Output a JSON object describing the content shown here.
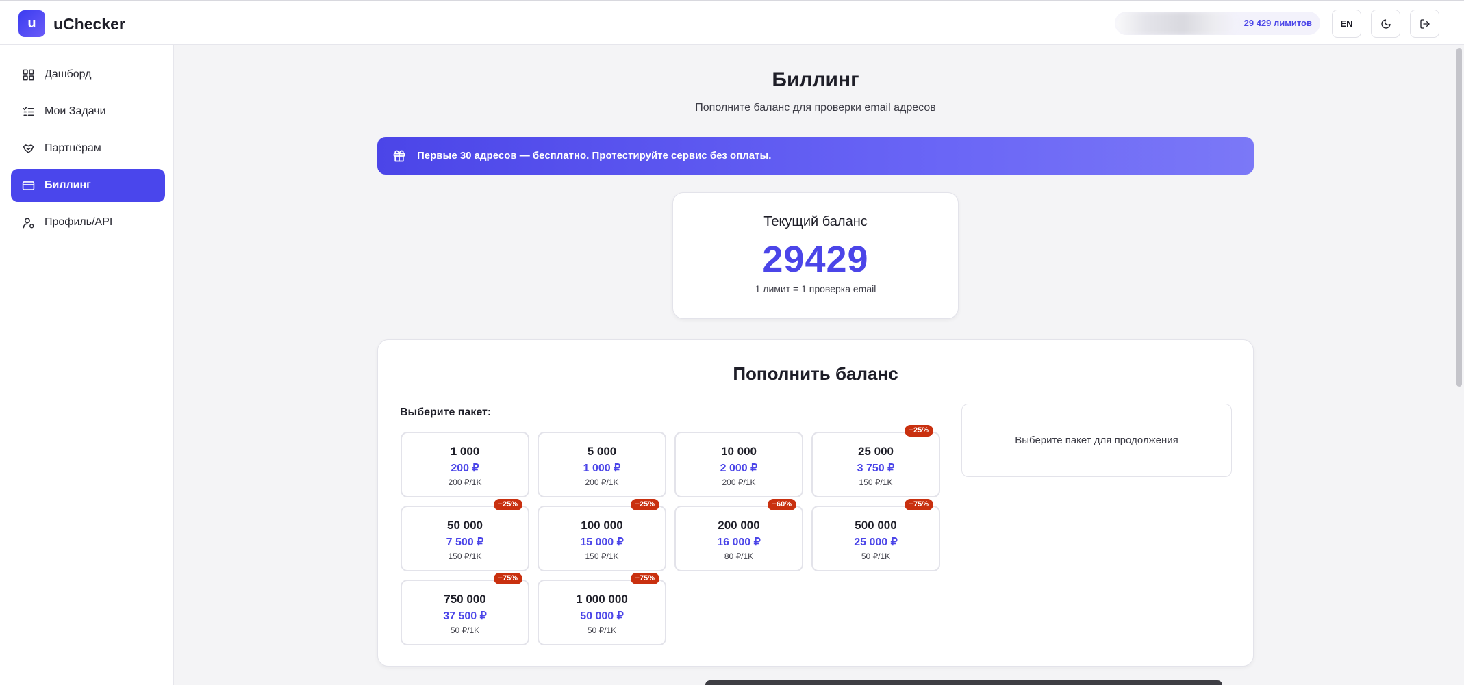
{
  "header": {
    "logo_letter": "u",
    "brand": "uChecker",
    "limits_badge": "29 429 лимитов",
    "lang_button": "EN"
  },
  "sidebar": {
    "items": [
      {
        "label": "Дашборд",
        "icon": "dashboard-icon",
        "active": false
      },
      {
        "label": "Мои Задачи",
        "icon": "task-list-icon",
        "active": false
      },
      {
        "label": "Партнёрам",
        "icon": "handshake-icon",
        "active": false
      },
      {
        "label": "Биллинг",
        "icon": "credit-card-icon",
        "active": true
      },
      {
        "label": "Профиль/API",
        "icon": "user-settings-icon",
        "active": false
      }
    ]
  },
  "main": {
    "title": "Биллинг",
    "subtitle": "Пополните баланс для проверки email адресов",
    "promo": "Первые 30 адресов — бесплатно. Протестируйте сервис без оплаты.",
    "balance": {
      "label": "Текущий баланс",
      "value": "29429",
      "note": "1 лимит = 1 проверка email"
    },
    "topup": {
      "title": "Пополнить баланс",
      "choose_label": "Выберите пакет:",
      "summary_placeholder": "Выберите пакет для продолжения",
      "packages": [
        {
          "amount": "1 000",
          "price": "200 ₽",
          "rate": "200 ₽/1K",
          "badge": ""
        },
        {
          "amount": "5 000",
          "price": "1 000 ₽",
          "rate": "200 ₽/1K",
          "badge": ""
        },
        {
          "amount": "10 000",
          "price": "2 000 ₽",
          "rate": "200 ₽/1K",
          "badge": ""
        },
        {
          "amount": "25 000",
          "price": "3 750 ₽",
          "rate": "150 ₽/1K",
          "badge": "−25%"
        },
        {
          "amount": "50 000",
          "price": "7 500 ₽",
          "rate": "150 ₽/1K",
          "badge": "−25%"
        },
        {
          "amount": "100 000",
          "price": "15 000 ₽",
          "rate": "150 ₽/1K",
          "badge": "−25%"
        },
        {
          "amount": "200 000",
          "price": "16 000 ₽",
          "rate": "80 ₽/1K",
          "badge": "−60%"
        },
        {
          "amount": "500 000",
          "price": "25 000 ₽",
          "rate": "50 ₽/1K",
          "badge": "−75%"
        },
        {
          "amount": "750 000",
          "price": "37 500 ₽",
          "rate": "50 ₽/1K",
          "badge": "−75%"
        },
        {
          "amount": "1 000 000",
          "price": "50 000 ₽",
          "rate": "50 ₽/1K",
          "badge": "−75%"
        }
      ]
    }
  },
  "colors": {
    "accent": "#4b45e8",
    "badge": "#c9300f",
    "background": "#f4f4f6"
  }
}
